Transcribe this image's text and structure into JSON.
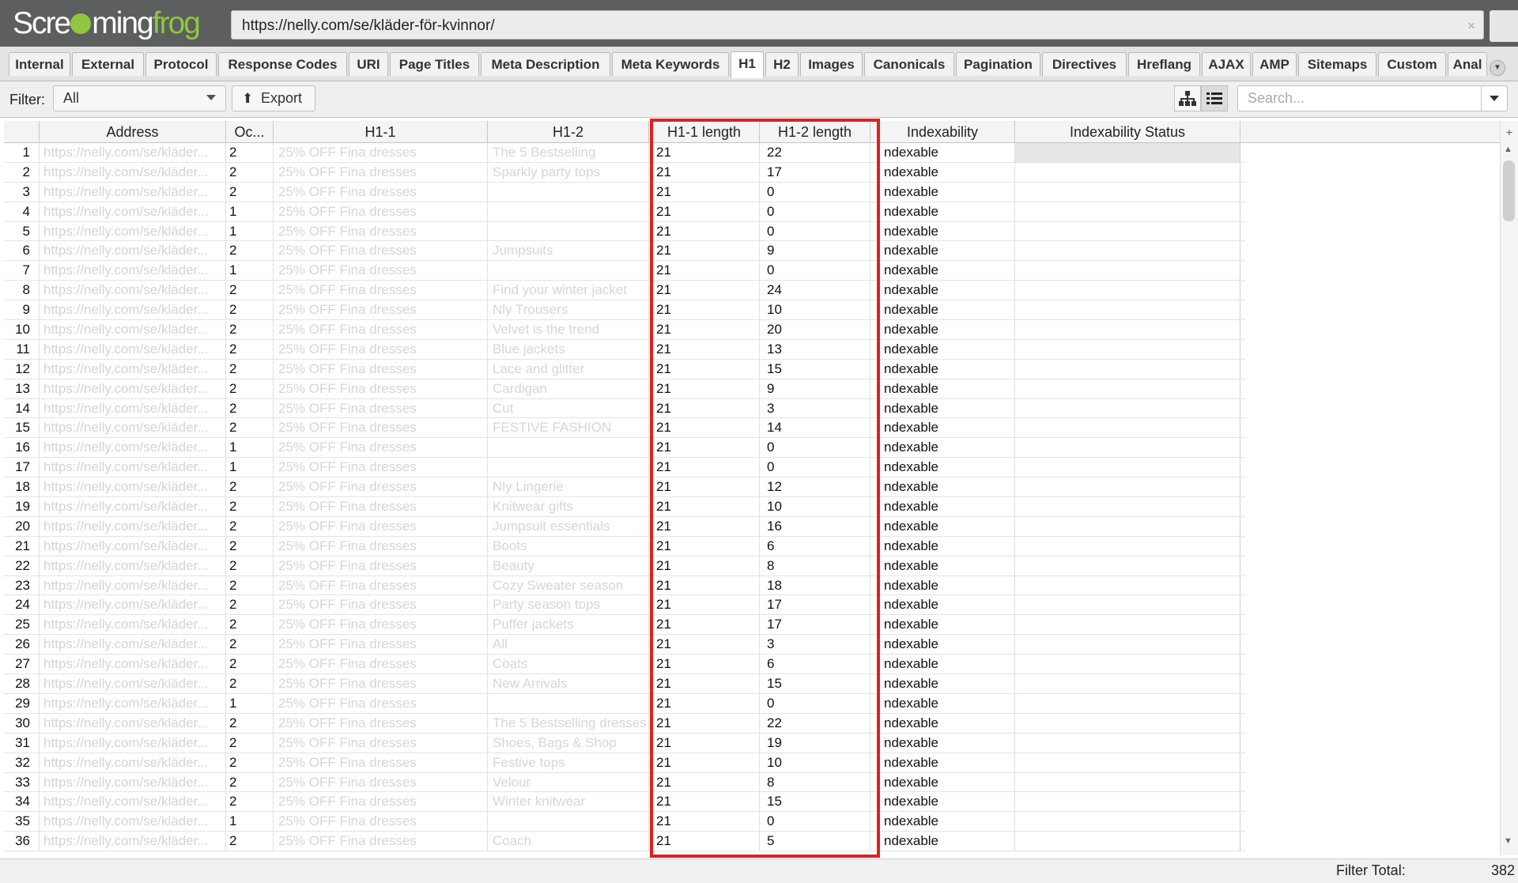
{
  "app": {
    "logo_prefix": "Scre",
    "logo_mid": "ming",
    "logo_suffix": "frog"
  },
  "url_bar": {
    "value": "https://nelly.com/se/kläder-för-kvinnor/",
    "clear_icon": "×"
  },
  "tabs": [
    {
      "label": "Internal"
    },
    {
      "label": "External"
    },
    {
      "label": "Protocol"
    },
    {
      "label": "Response Codes"
    },
    {
      "label": "URI"
    },
    {
      "label": "Page Titles"
    },
    {
      "label": "Meta Description"
    },
    {
      "label": "Meta Keywords"
    },
    {
      "label": "H1",
      "active": true
    },
    {
      "label": "H2"
    },
    {
      "label": "Images"
    },
    {
      "label": "Canonicals"
    },
    {
      "label": "Pagination"
    },
    {
      "label": "Directives"
    },
    {
      "label": "Hreflang"
    },
    {
      "label": "AJAX"
    },
    {
      "label": "AMP"
    },
    {
      "label": "Sitemaps"
    },
    {
      "label": "Custom"
    },
    {
      "label": "Anal"
    }
  ],
  "filter": {
    "label": "Filter:",
    "selected": "All",
    "export_label": "Export",
    "search_placeholder": "Search..."
  },
  "table": {
    "columns": {
      "address": "Address",
      "occurrences": "Oc...",
      "h1_1": "H1-1",
      "h1_2": "H1-2",
      "h1_1_length": "H1-1 length",
      "h1_2_length": "H1-2 length",
      "indexability": "Indexability",
      "indexability_status": "Indexability Status"
    },
    "rows": [
      {
        "n": "1",
        "addr": "https://nelly.com/se/kläder...",
        "occ": "2",
        "h1": "25% OFF Fina dresses",
        "h2": "The 5 Bestselling",
        "l1": "21",
        "l2": "22",
        "idx": "ndexable"
      },
      {
        "n": "2",
        "addr": "https://nelly.com/se/kläder...",
        "occ": "2",
        "h1": "25% OFF Fina dresses",
        "h2": "Sparkly party tops",
        "l1": "21",
        "l2": "17",
        "idx": "ndexable"
      },
      {
        "n": "3",
        "addr": "https://nelly.com/se/kläder...",
        "occ": "2",
        "h1": "25% OFF Fina dresses",
        "h2": "",
        "l1": "21",
        "l2": "0",
        "idx": "ndexable"
      },
      {
        "n": "4",
        "addr": "https://nelly.com/se/kläder...",
        "occ": "1",
        "h1": "25% OFF Fina dresses",
        "h2": "",
        "l1": "21",
        "l2": "0",
        "idx": "ndexable"
      },
      {
        "n": "5",
        "addr": "https://nelly.com/se/kläder...",
        "occ": "1",
        "h1": "25% OFF Fina dresses",
        "h2": "",
        "l1": "21",
        "l2": "0",
        "idx": "ndexable"
      },
      {
        "n": "6",
        "addr": "https://nelly.com/se/kläder...",
        "occ": "2",
        "h1": "25% OFF Fina dresses",
        "h2": "Jumpsuits",
        "l1": "21",
        "l2": "9",
        "idx": "ndexable"
      },
      {
        "n": "7",
        "addr": "https://nelly.com/se/kläder...",
        "occ": "1",
        "h1": "25% OFF Fina dresses",
        "h2": "",
        "l1": "21",
        "l2": "0",
        "idx": "ndexable"
      },
      {
        "n": "8",
        "addr": "https://nelly.com/se/kläder...",
        "occ": "2",
        "h1": "25% OFF Fina dresses",
        "h2": "Find your winter jacket",
        "l1": "21",
        "l2": "24",
        "idx": "ndexable"
      },
      {
        "n": "9",
        "addr": "https://nelly.com/se/kläder...",
        "occ": "2",
        "h1": "25% OFF Fina dresses",
        "h2": "Nly Trousers",
        "l1": "21",
        "l2": "10",
        "idx": "ndexable"
      },
      {
        "n": "10",
        "addr": "https://nelly.com/se/kläder...",
        "occ": "2",
        "h1": "25% OFF Fina dresses",
        "h2": "Velvet is the trend",
        "l1": "21",
        "l2": "20",
        "idx": "ndexable"
      },
      {
        "n": "11",
        "addr": "https://nelly.com/se/kläder...",
        "occ": "2",
        "h1": "25% OFF Fina dresses",
        "h2": "Blue jackets",
        "l1": "21",
        "l2": "13",
        "idx": "ndexable"
      },
      {
        "n": "12",
        "addr": "https://nelly.com/se/kläder...",
        "occ": "2",
        "h1": "25% OFF Fina dresses",
        "h2": "Lace and glitter",
        "l1": "21",
        "l2": "15",
        "idx": "ndexable"
      },
      {
        "n": "13",
        "addr": "https://nelly.com/se/kläder...",
        "occ": "2",
        "h1": "25% OFF Fina dresses",
        "h2": "Cardigan",
        "l1": "21",
        "l2": "9",
        "idx": "ndexable"
      },
      {
        "n": "14",
        "addr": "https://nelly.com/se/kläder...",
        "occ": "2",
        "h1": "25% OFF Fina dresses",
        "h2": "Cut",
        "l1": "21",
        "l2": "3",
        "idx": "ndexable"
      },
      {
        "n": "15",
        "addr": "https://nelly.com/se/kläder...",
        "occ": "2",
        "h1": "25% OFF Fina dresses",
        "h2": "FESTIVE FASHION",
        "l1": "21",
        "l2": "14",
        "idx": "ndexable"
      },
      {
        "n": "16",
        "addr": "https://nelly.com/se/kläder...",
        "occ": "1",
        "h1": "25% OFF Fina dresses",
        "h2": "",
        "l1": "21",
        "l2": "0",
        "idx": "ndexable"
      },
      {
        "n": "17",
        "addr": "https://nelly.com/se/kläder...",
        "occ": "1",
        "h1": "25% OFF Fina dresses",
        "h2": "",
        "l1": "21",
        "l2": "0",
        "idx": "ndexable"
      },
      {
        "n": "18",
        "addr": "https://nelly.com/se/kläder...",
        "occ": "2",
        "h1": "25% OFF Fina dresses",
        "h2": "Nly Lingerie",
        "l1": "21",
        "l2": "12",
        "idx": "ndexable"
      },
      {
        "n": "19",
        "addr": "https://nelly.com/se/kläder...",
        "occ": "2",
        "h1": "25% OFF Fina dresses",
        "h2": "Knitwear gifts",
        "l1": "21",
        "l2": "10",
        "idx": "ndexable"
      },
      {
        "n": "20",
        "addr": "https://nelly.com/se/kläder...",
        "occ": "2",
        "h1": "25% OFF Fina dresses",
        "h2": "Jumpsuit essentials",
        "l1": "21",
        "l2": "16",
        "idx": "ndexable"
      },
      {
        "n": "21",
        "addr": "https://nelly.com/se/kläder...",
        "occ": "2",
        "h1": "25% OFF Fina dresses",
        "h2": "Boots",
        "l1": "21",
        "l2": "6",
        "idx": "ndexable"
      },
      {
        "n": "22",
        "addr": "https://nelly.com/se/kläder...",
        "occ": "2",
        "h1": "25% OFF Fina dresses",
        "h2": "Beauty",
        "l1": "21",
        "l2": "8",
        "idx": "ndexable"
      },
      {
        "n": "23",
        "addr": "https://nelly.com/se/kläder...",
        "occ": "2",
        "h1": "25% OFF Fina dresses",
        "h2": "Cozy Sweater season",
        "l1": "21",
        "l2": "18",
        "idx": "ndexable"
      },
      {
        "n": "24",
        "addr": "https://nelly.com/se/kläder...",
        "occ": "2",
        "h1": "25% OFF Fina dresses",
        "h2": "Party season tops",
        "l1": "21",
        "l2": "17",
        "idx": "ndexable"
      },
      {
        "n": "25",
        "addr": "https://nelly.com/se/kläder...",
        "occ": "2",
        "h1": "25% OFF Fina dresses",
        "h2": "Puffer jackets",
        "l1": "21",
        "l2": "17",
        "idx": "ndexable"
      },
      {
        "n": "26",
        "addr": "https://nelly.com/se/kläder...",
        "occ": "2",
        "h1": "25% OFF Fina dresses",
        "h2": "All",
        "l1": "21",
        "l2": "3",
        "idx": "ndexable"
      },
      {
        "n": "27",
        "addr": "https://nelly.com/se/kläder...",
        "occ": "2",
        "h1": "25% OFF Fina dresses",
        "h2": "Coats",
        "l1": "21",
        "l2": "6",
        "idx": "ndexable"
      },
      {
        "n": "28",
        "addr": "https://nelly.com/se/kläder...",
        "occ": "2",
        "h1": "25% OFF Fina dresses",
        "h2": "New Arrivals",
        "l1": "21",
        "l2": "15",
        "idx": "ndexable"
      },
      {
        "n": "29",
        "addr": "https://nelly.com/se/kläder...",
        "occ": "1",
        "h1": "25% OFF Fina dresses",
        "h2": "",
        "l1": "21",
        "l2": "0",
        "idx": "ndexable"
      },
      {
        "n": "30",
        "addr": "https://nelly.com/se/kläder...",
        "occ": "2",
        "h1": "25% OFF Fina dresses",
        "h2": "The 5 Bestselling dresses",
        "l1": "21",
        "l2": "22",
        "idx": "ndexable"
      },
      {
        "n": "31",
        "addr": "https://nelly.com/se/kläder...",
        "occ": "2",
        "h1": "25% OFF Fina dresses",
        "h2": "Shoes, Bags & Shop",
        "l1": "21",
        "l2": "19",
        "idx": "ndexable"
      },
      {
        "n": "32",
        "addr": "https://nelly.com/se/kläder...",
        "occ": "2",
        "h1": "25% OFF Fina dresses",
        "h2": "Festive tops",
        "l1": "21",
        "l2": "10",
        "idx": "ndexable"
      },
      {
        "n": "33",
        "addr": "https://nelly.com/se/kläder...",
        "occ": "2",
        "h1": "25% OFF Fina dresses",
        "h2": "Velour",
        "l1": "21",
        "l2": "8",
        "idx": "ndexable"
      },
      {
        "n": "34",
        "addr": "https://nelly.com/se/kläder...",
        "occ": "2",
        "h1": "25% OFF Fina dresses",
        "h2": "Winter knitwear",
        "l1": "21",
        "l2": "15",
        "idx": "ndexable"
      },
      {
        "n": "35",
        "addr": "https://nelly.com/se/kläder...",
        "occ": "1",
        "h1": "25% OFF Fina dresses",
        "h2": "",
        "l1": "21",
        "l2": "0",
        "idx": "ndexable"
      },
      {
        "n": "36",
        "addr": "https://nelly.com/se/kläder...",
        "occ": "2",
        "h1": "25% OFF Fina dresses",
        "h2": "Coach",
        "l1": "21",
        "l2": "5",
        "idx": "ndexable"
      }
    ]
  },
  "status": {
    "filter_total_label": "Filter Total:",
    "filter_total_value": "382"
  },
  "colors": {
    "highlight": "#e02020",
    "brand_green": "#8fc740",
    "topbar": "#5d5e5e"
  }
}
